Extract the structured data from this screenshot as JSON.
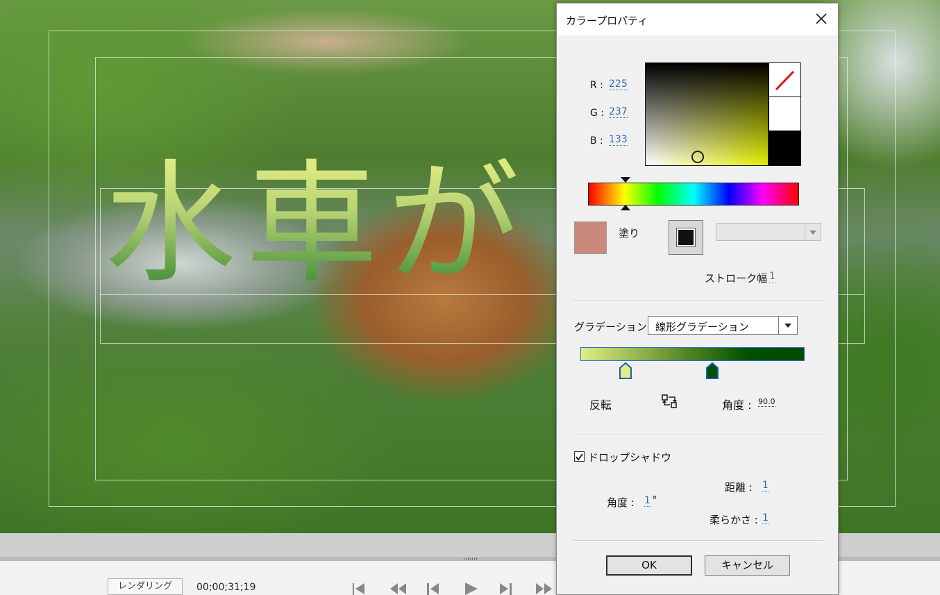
{
  "preview": {
    "title_text": "水車が"
  },
  "bottom_bar": {
    "render_button": "レンダリング",
    "timecode": "00;00;31;19"
  },
  "dialog": {
    "title": "カラープロパティ",
    "rgb": {
      "r_label": "R :",
      "r_value": "225",
      "g_label": "G :",
      "g_value": "237",
      "b_label": "B :",
      "b_value": "133"
    },
    "fill_label": "塗り",
    "fill_color": "#c98a7c",
    "stroke_width_label": "ストローク幅",
    "stroke_width_value": "1",
    "gradation_label": "グラデーション",
    "gradation_type": "線形グラデーション",
    "gradient_stops": [
      "#e1ed85",
      "#005000"
    ],
    "reverse_label": "反転",
    "angle_label": "角度 :",
    "angle_value": "90.0",
    "drop_shadow": {
      "checked": true,
      "label": "ドロップシャドウ",
      "angle_label": "角度 :",
      "angle_value": "1",
      "angle_unit": "°",
      "distance_label": "距離 :",
      "distance_value": "1",
      "softness_label": "柔らかさ :",
      "softness_value": "1"
    },
    "ok_label": "OK",
    "cancel_label": "キャンセル"
  }
}
